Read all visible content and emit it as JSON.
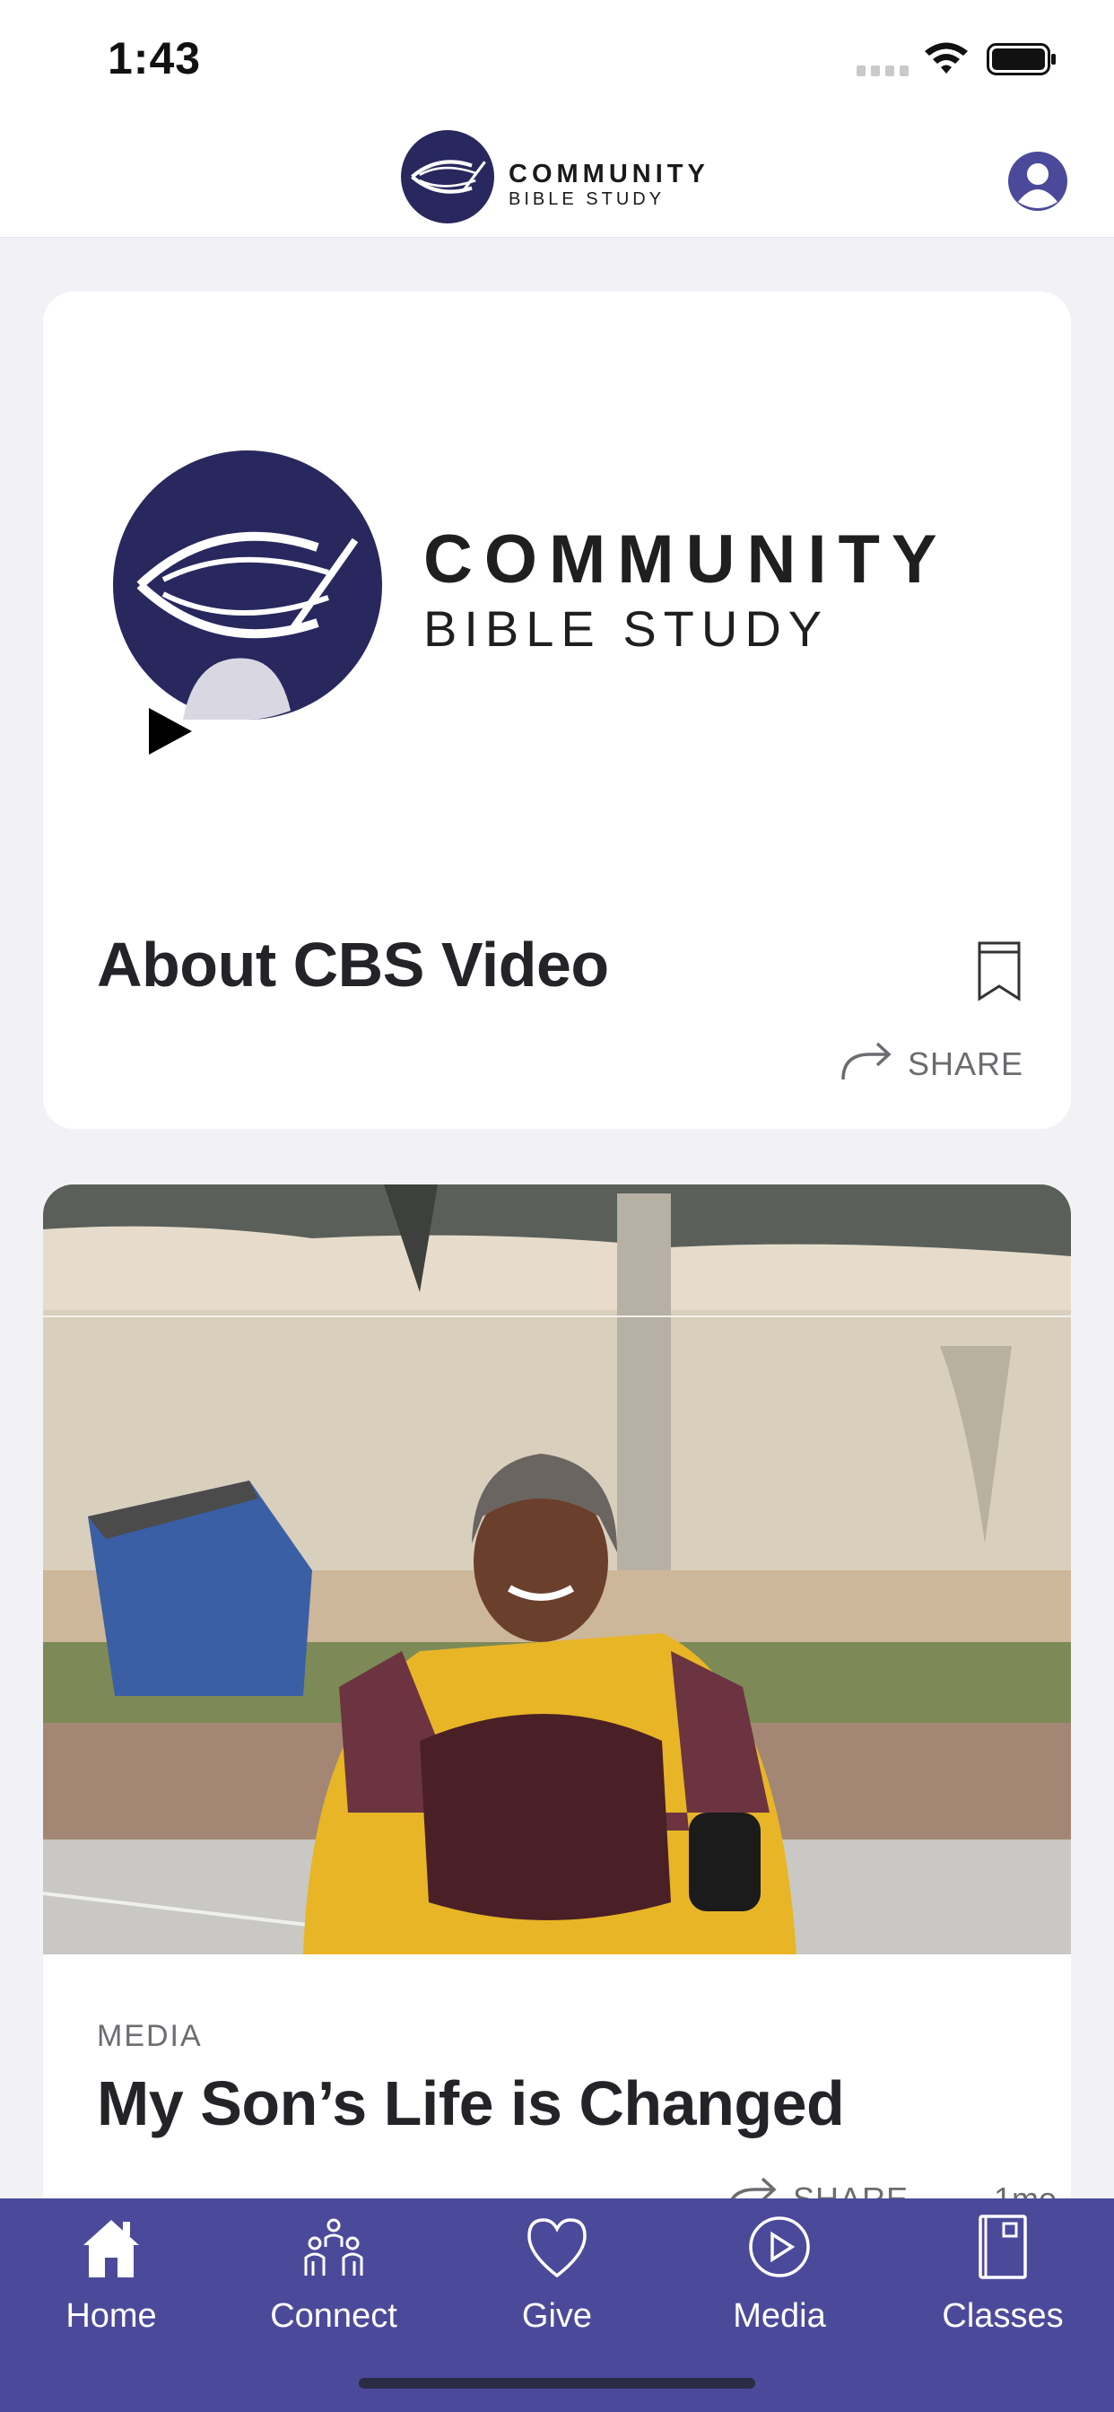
{
  "status_bar": {
    "time": "1:43",
    "icons": [
      "signal-icon",
      "wifi-icon",
      "battery-icon"
    ]
  },
  "header": {
    "logo_line1": "COMMUNITY",
    "logo_line2": "BIBLE STUDY",
    "avatar_icon": "user-icon"
  },
  "feed": {
    "cards": [
      {
        "thumbnail_logo_line1": "COMMUNITY",
        "thumbnail_logo_line2": "BIBLE STUDY",
        "title": "About CBS Video",
        "share_label": "SHARE",
        "icons": [
          "play-icon",
          "bookmark-icon",
          "share-icon"
        ]
      },
      {
        "category": "MEDIA",
        "title": "My Son’s Life is Changed",
        "share_label": "SHARE",
        "age": "1mo",
        "icons": [
          "share-icon"
        ]
      }
    ]
  },
  "tab_bar": {
    "tabs": [
      {
        "label": "Home",
        "icon": "home-icon"
      },
      {
        "label": "Connect",
        "icon": "people-icon"
      },
      {
        "label": "Give",
        "icon": "heart-icon"
      },
      {
        "label": "Media",
        "icon": "play-circle-icon"
      },
      {
        "label": "Classes",
        "icon": "book-icon"
      }
    ]
  },
  "colors": {
    "brand_navy": "#28285f",
    "tab_bar": "#4b4a9a",
    "background": "#f2f2f6",
    "secondary_text": "#6c6c70"
  }
}
